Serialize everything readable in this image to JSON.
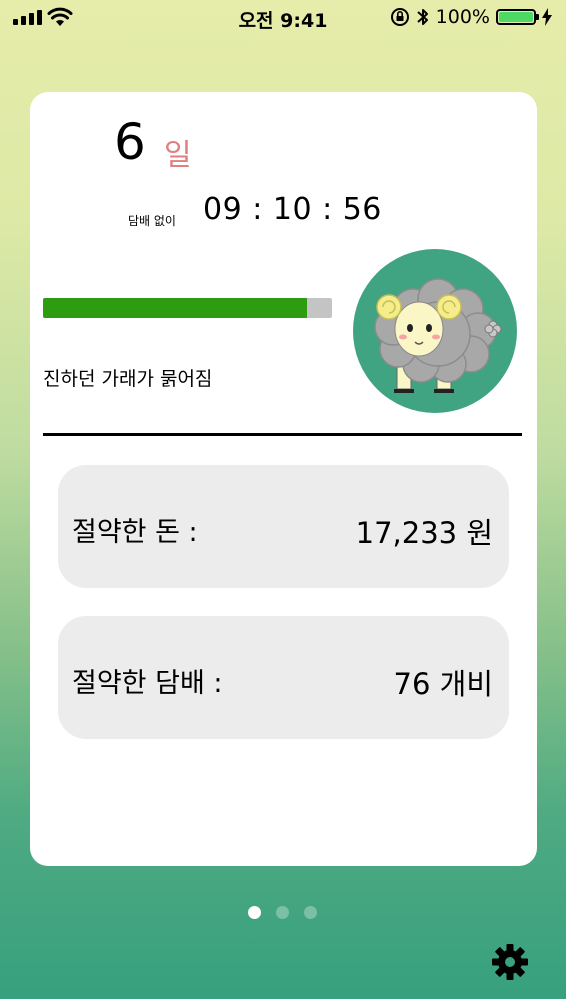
{
  "status_bar": {
    "time": "오전 9:41",
    "battery_percent": "100%",
    "battery_level": 1.0,
    "icons": [
      "signal-icon",
      "wifi-icon",
      "orientation-lock-icon",
      "bluetooth-icon",
      "battery-icon",
      "charging-icon"
    ]
  },
  "quit": {
    "days": "6",
    "days_unit": "일",
    "without_smoking_label": "담배 없이",
    "timer": "09 : 10 : 56",
    "progress": 0.915,
    "health_message": "진하던 가래가 묽어짐",
    "avatar_icon": "sheep-icon"
  },
  "stats": [
    {
      "label": "절약한 돈 :",
      "value": "17,233 원"
    },
    {
      "label": "절약한 담배 :",
      "value": "76 개비"
    }
  ],
  "pager": {
    "count": 3,
    "active": 0
  },
  "settings_icon": "gear-icon",
  "colors": {
    "days_unit": "#e07f80",
    "progress_fill": "#2e9c10",
    "progress_track": "#c4c4c4",
    "avatar_bg": "#40a382",
    "stat_box_bg": "#ececec"
  }
}
